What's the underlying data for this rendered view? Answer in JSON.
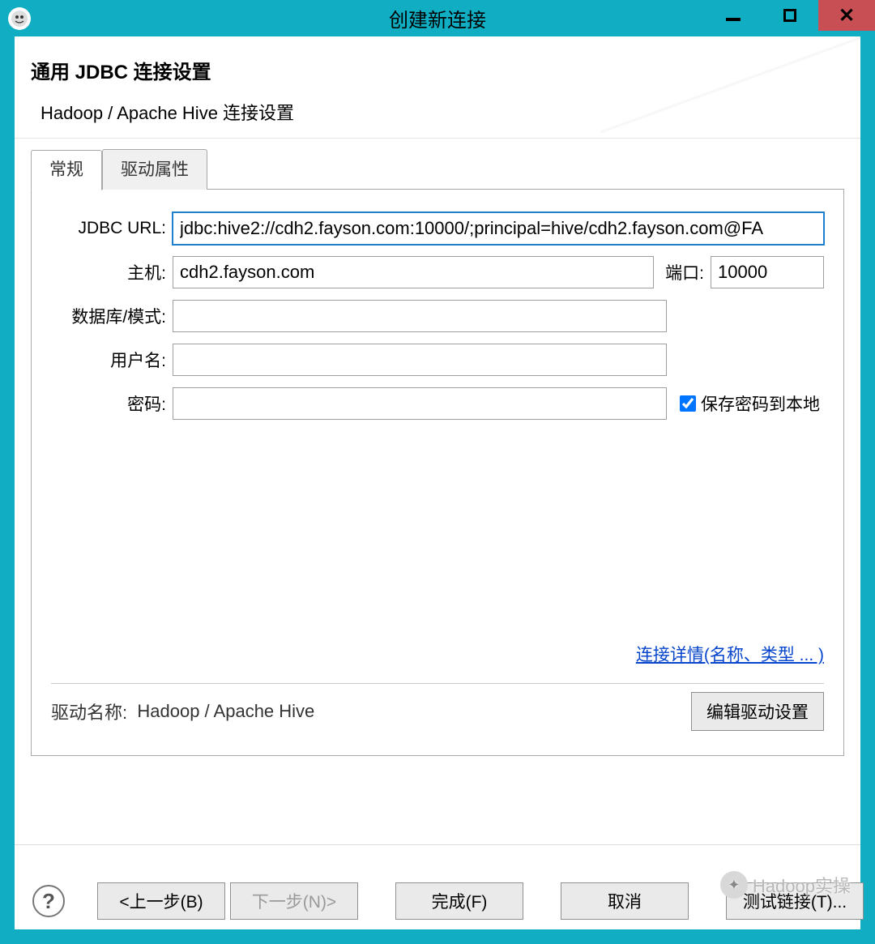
{
  "titlebar": {
    "title": "创建新连接"
  },
  "header": {
    "pageTitle": "通用 JDBC 连接设置",
    "subtitle": "Hadoop / Apache Hive 连接设置"
  },
  "tabs": {
    "general": "常规",
    "driverProps": "驱动属性"
  },
  "form": {
    "jdbcUrlLabel": "JDBC URL:",
    "jdbcUrl": "jdbc:hive2://cdh2.fayson.com:10000/;principal=hive/cdh2.fayson.com@FA",
    "hostLabel": "主机:",
    "host": "cdh2.fayson.com",
    "portLabel": "端口:",
    "port": "10000",
    "dbLabel": "数据库/模式:",
    "db": "",
    "userLabel": "用户名:",
    "user": "",
    "passLabel": "密码:",
    "pass": "",
    "savePasswordLabel": "保存密码到本地"
  },
  "link": {
    "detailsLink": "连接详情(名称、类型 ... )"
  },
  "driver": {
    "driverNameLabel": "驱动名称:",
    "driverName": "Hadoop / Apache Hive",
    "editDriverBtn": "编辑驱动设置"
  },
  "footer": {
    "back": "<上一步(B)",
    "next": "下一步(N)>",
    "finish": "完成(F)",
    "cancel": "取消",
    "test": "测试链接(T)..."
  },
  "watermark": {
    "text": "Hadoop实操"
  }
}
